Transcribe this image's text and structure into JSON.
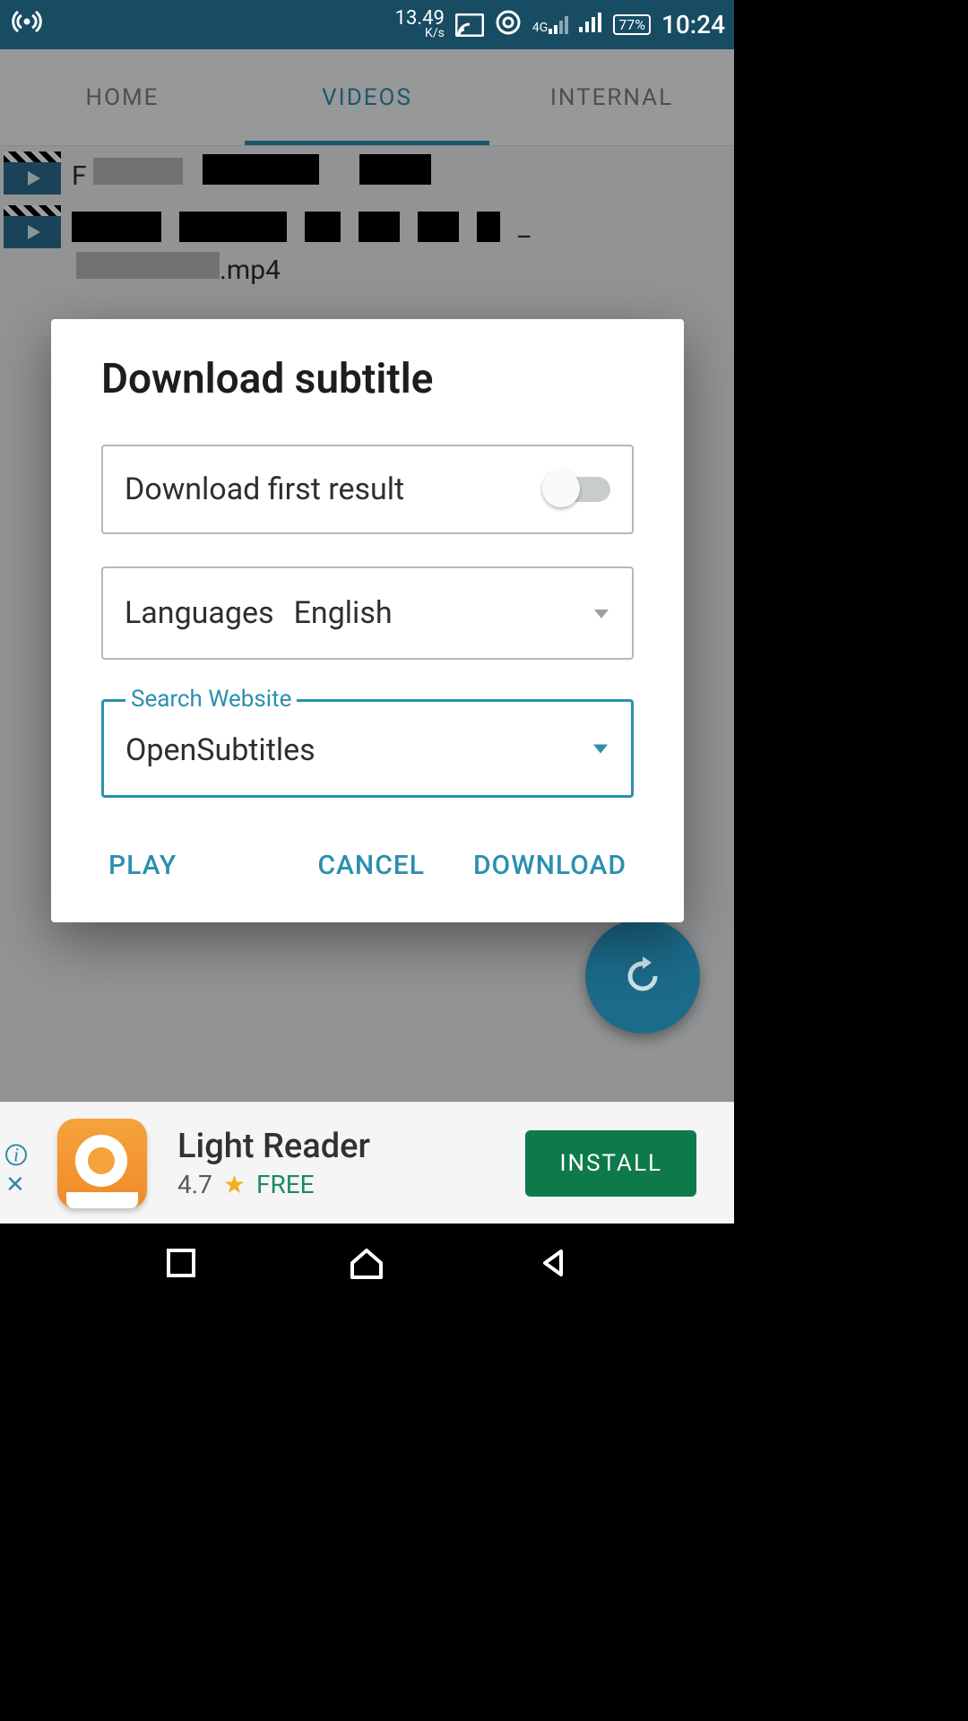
{
  "status_bar": {
    "hotspot_icon": "((•))",
    "net_speed_value": "13.49",
    "net_speed_unit": "K/s",
    "network_type": "4G",
    "battery": "77%",
    "time": "10:24"
  },
  "tabs": {
    "home": "HOME",
    "videos": "VIDEOS",
    "internal": "INTERNAL",
    "active": "videos"
  },
  "video_list": {
    "item1_partial": "F",
    "item2_suffix": "_",
    "item2_line2_suffix": ".mp4"
  },
  "dialog": {
    "title": "Download subtitle",
    "download_first_label": "Download first result",
    "download_first_enabled": false,
    "languages_label": "Languages",
    "languages_value": "English",
    "search_website_label": "Search Website",
    "search_website_value": "OpenSubtitles",
    "actions": {
      "play": "PLAY",
      "cancel": "CANCEL",
      "download": "DOWNLOAD"
    }
  },
  "ad": {
    "title": "Light Reader",
    "rating": "4.7",
    "price": "FREE",
    "install": "INSTALL"
  },
  "fab_icon": "refresh-icon"
}
